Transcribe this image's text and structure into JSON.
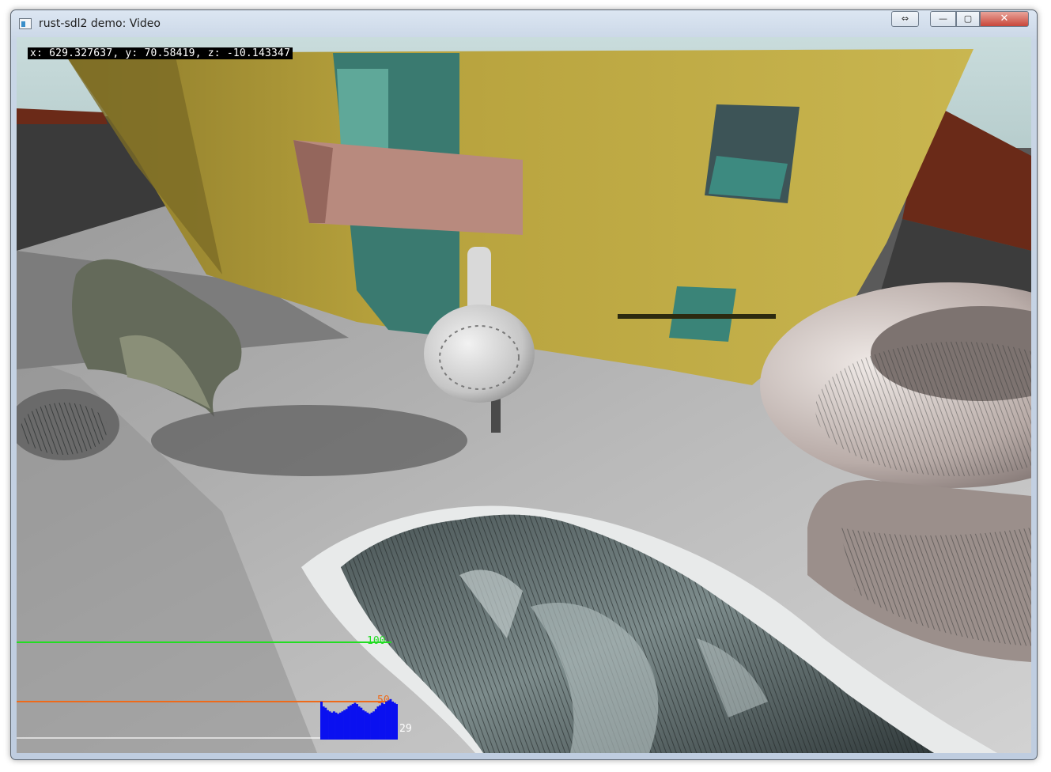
{
  "window": {
    "title": "rust-sdl2 demo: Video",
    "buttons": {
      "aux": "⇔",
      "minimize": "—",
      "maximize": "▢",
      "close": "✕"
    }
  },
  "hud": {
    "coords": "x: 629.327637, y: 70.58419, z: -10.143347"
  },
  "perf_graph": {
    "lines": [
      {
        "label": "100",
        "color": "#22dd22"
      },
      {
        "label": "50",
        "color": "#ee6a1a"
      },
      {
        "label": "29",
        "color": "#ffffff"
      }
    ],
    "bar_color": "#0a10f0",
    "samples": [
      28,
      27,
      26,
      24,
      23,
      22,
      23,
      22,
      21,
      22,
      23,
      24,
      25,
      27,
      28,
      29,
      30,
      29,
      27,
      26,
      24,
      23,
      22,
      21,
      22,
      23,
      25,
      27,
      28,
      30,
      29,
      31,
      32,
      33,
      31,
      30,
      29
    ]
  }
}
